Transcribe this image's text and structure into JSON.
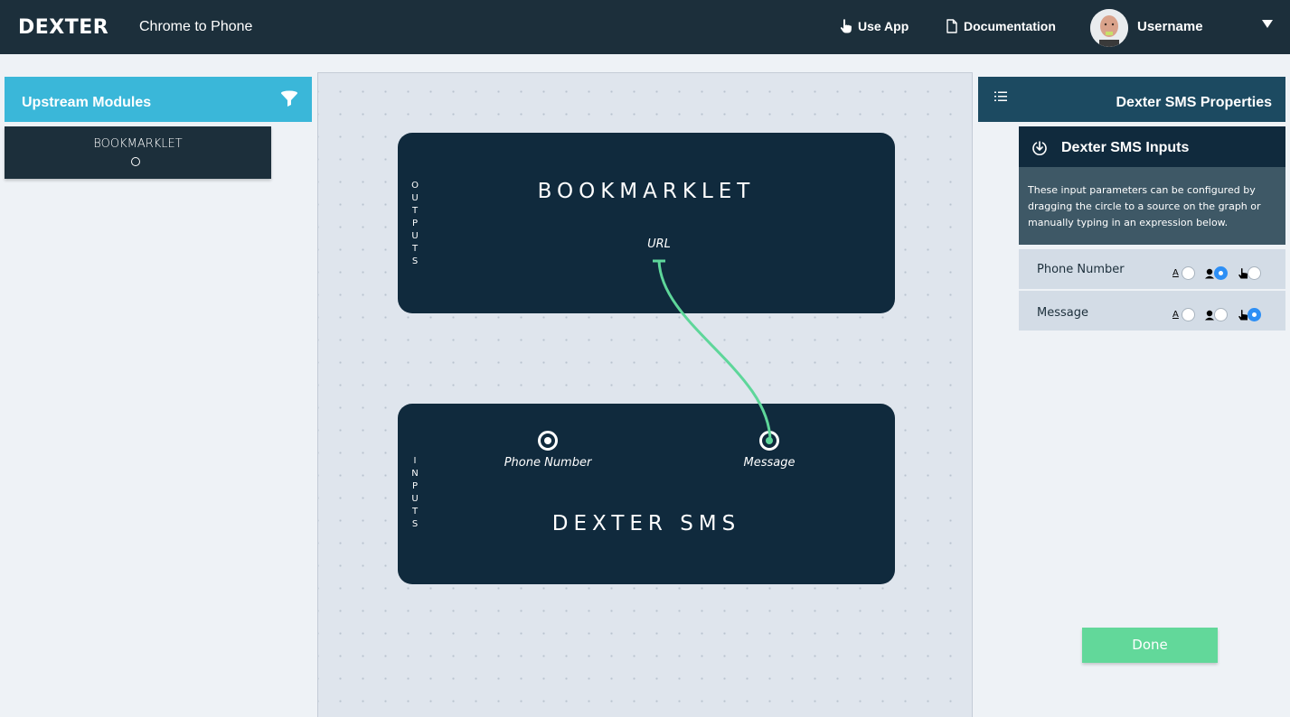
{
  "header": {
    "logo": "DEXTER",
    "app_title": "Chrome to Phone",
    "use_app": "Use App",
    "documentation": "Documentation",
    "username": "Username"
  },
  "upstream": {
    "title": "Upstream Modules",
    "modules": [
      {
        "label": "BOOKMARKLET"
      }
    ]
  },
  "graph": {
    "source_node": {
      "side_label": "OUTPUTS",
      "title": "BOOKMARKLET",
      "output_port": "URL"
    },
    "target_node": {
      "side_label": "INPUTS",
      "title": "DEXTER SMS",
      "input_ports": [
        "Phone Number",
        "Message"
      ]
    },
    "connection": {
      "from": "URL",
      "to": "Message",
      "color": "#5ed69a"
    }
  },
  "properties": {
    "title": "Dexter SMS Properties",
    "inputs_title": "Dexter SMS Inputs",
    "info": "These input parameters can be configured by dragging the circle to a source on the graph or manually typing in an expression below.",
    "params": [
      {
        "label": "Phone Number",
        "options": [
          "text",
          "user",
          "pointer"
        ],
        "selected": "user"
      },
      {
        "label": "Message",
        "options": [
          "text",
          "user",
          "pointer"
        ],
        "selected": "pointer"
      }
    ],
    "done_label": "Done"
  },
  "colors": {
    "header_bg": "#1c2f3b",
    "upstream_accent": "#3ab7d9",
    "node_bg": "#102a3d",
    "radio_selected": "#2d8ff5",
    "done_bg": "#62d89a"
  }
}
